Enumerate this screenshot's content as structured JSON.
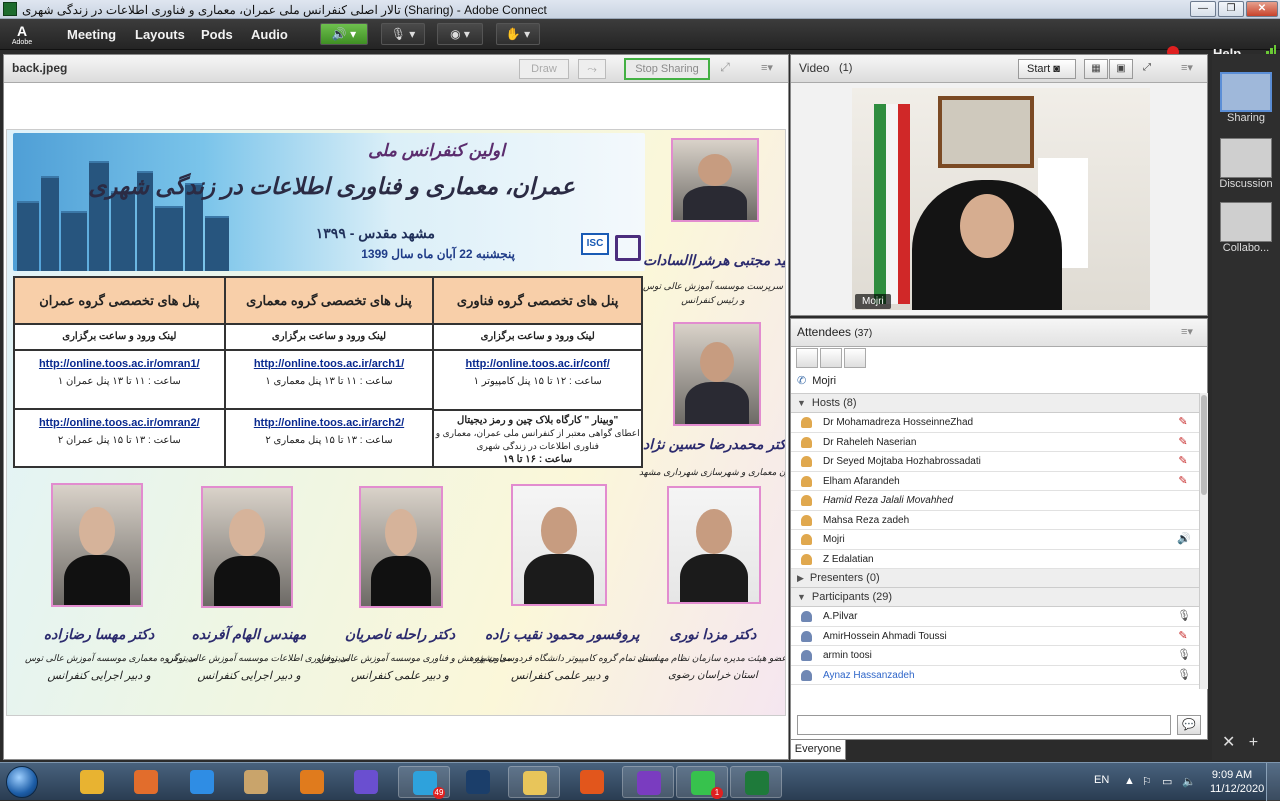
{
  "window": {
    "title": "تالار اصلی کنفرانس ملی عمران، معماری و فناوری اطلاعات در زندگی شهری (Sharing) - Adobe Connect",
    "min": "—",
    "max": "❐",
    "close": "✕"
  },
  "menubar": {
    "logo": "A",
    "logo_sub": "Adobe",
    "items": [
      "Meeting",
      "Layouts",
      "Pods",
      "Audio"
    ],
    "help": "Help"
  },
  "share_pod": {
    "title": "back.jpeg",
    "draw": "Draw",
    "stop_sharing": "Stop Sharing",
    "menu": "≡▾"
  },
  "slide": {
    "banner": {
      "conf": "اولین کنفرانس ملی",
      "title": "عمران، معماری و فناوری اطلاعات در زندگی شهری",
      "city": "۱۳۹۹ - مشهد مقدس",
      "date": "پنجشنبه 22 آبان ماه سال 1399",
      "isc": "ISC"
    },
    "panels": [
      {
        "heading": "پنل های تخصصی گروه عمران",
        "sub": "لینک ورود و ساعت برگزاری",
        "cells": [
          {
            "link": "http://online.toos.ac.ir/omran1/",
            "line1": "ساعت : ۱۱ تا ۱۳     پنل عمران ۱",
            "line2": ""
          },
          {
            "link": "http://online.toos.ac.ir/omran2/",
            "line1": "ساعت : ۱۳ تا ۱۵     پنل عمران ۲",
            "line2": ""
          }
        ]
      },
      {
        "heading": "پنل های تخصصی گروه معماری",
        "sub": "لینک ورود و ساعت برگزاری",
        "cells": [
          {
            "link": "http://online.toos.ac.ir/arch1/",
            "line1": "ساعت : ۱۱ تا ۱۳     پنل معماری ۱",
            "line2": ""
          },
          {
            "link": "http://online.toos.ac.ir/arch2/",
            "line1": "ساعت : ۱۳ تا ۱۵     پنل معماری ۲",
            "line2": ""
          }
        ]
      },
      {
        "heading": "پنل های تخصصی گروه فناوری اطلاعات",
        "sub": "لینک ورود و ساعت برگزاری",
        "cells": [
          {
            "link": "http://online.toos.ac.ir/conf/",
            "line1": "ساعت : ۱۲ تا ۱۵     پنل کامپیوتر ۱",
            "line2": ""
          },
          {
            "link": "وبینار \" کارگاه بلاک چین و رمز دیجیتال\"",
            "line1": "اعطای گواهی معتبر از کنفرانس ملی عمران، معماری و",
            "line2": "فناوری اطلاعات در زندگی شهری",
            "line3": "ساعت : ۱۶ تا ۱۹"
          }
        ]
      }
    ],
    "people_right": [
      {
        "name": "دکتر سید مجتبی هرشراالسادات",
        "role1": "سرپرست موسسه آموزش عالی توس",
        "role2": "و رئیس کنفرانس"
      },
      {
        "name": "دکتر محمدرضا حسین نژاد",
        "role1": "معاون معماری و شهرسازی شهرداری مشهد",
        "role2": ""
      }
    ],
    "people_bottom": [
      {
        "name": "دکتر مهسا رضازاده",
        "role1": "مدیر گروه معماری موسسه آموزش عالی توس",
        "role2": "و دبیر اجرایی کنفرانس"
      },
      {
        "name": "مهندس الهام آفرنده",
        "role1": "مدیر فناوری اطلاعات موسسه آموزش عالی توس",
        "role2": "و دبیر اجرایی کنفرانس"
      },
      {
        "name": "دکتر راحله ناصریان",
        "role1": "معاون پژوهش و فناوری موسسه آموزش عالی توس",
        "role2": "و دبیر علمی کنفرانس"
      },
      {
        "name": "پروفسور محمود نقیب زاده",
        "role1": "استاد تمام گروه کامپیوتر دانشگاه فردوسی مشهد",
        "role2": "و دبیر علمی کنفرانس"
      },
      {
        "name": "دکتر مزدا نوری",
        "role1": "عضو هیئت مدیره سازمان نظام مهندسی",
        "role2": "استان خراسان رضوی"
      }
    ]
  },
  "video_pod": {
    "title": "Video",
    "count": "(1)",
    "start": "Start",
    "menu": "≡▾",
    "speaker_name": "Mojri"
  },
  "attendees": {
    "title": "Attendees",
    "count": "(37)",
    "menu": "≡▾",
    "audio_speaker": "Mojri",
    "groups": [
      {
        "label": "Hosts (8)",
        "expanded": true,
        "members": [
          {
            "name": "Dr Mohamadreza HosseinneZhad",
            "icon": "mic-off-icon",
            "style": ""
          },
          {
            "name": "Dr Raheleh Naserian",
            "icon": "mic-off-icon",
            "style": ""
          },
          {
            "name": "Dr Seyed Mojtaba Hozhabrossadati",
            "icon": "mic-off-icon",
            "style": ""
          },
          {
            "name": "Elham Afarandeh",
            "icon": "mic-off-icon",
            "style": ""
          },
          {
            "name": "Hamid Reza Jalali Movahhed",
            "icon": "",
            "style": "italic"
          },
          {
            "name": "Mahsa Reza zadeh",
            "icon": "",
            "style": ""
          },
          {
            "name": "Mojri",
            "icon": "speaking-icon",
            "style": ""
          },
          {
            "name": "Z Edalatian",
            "icon": "",
            "style": ""
          }
        ]
      },
      {
        "label": "Presenters (0)",
        "expanded": false,
        "members": []
      },
      {
        "label": "Participants (29)",
        "expanded": true,
        "members": [
          {
            "name": "A.Pilvar",
            "icon": "mic-icon",
            "style": ""
          },
          {
            "name": "AmirHossein Ahmadi Toussi",
            "icon": "mic-off-icon",
            "style": ""
          },
          {
            "name": "armin toosi",
            "icon": "mic-icon",
            "style": ""
          },
          {
            "name": "Aynaz Hassanzadeh",
            "icon": "mic-icon",
            "style": "selected"
          }
        ]
      }
    ],
    "chat_tab": "Everyone"
  },
  "layouts": [
    {
      "label": "Sharing",
      "active": true
    },
    {
      "label": "Discussion",
      "active": false
    },
    {
      "label": "Collabo...",
      "active": false
    }
  ],
  "taskbar": {
    "lang": "EN",
    "time": "9:09 AM",
    "date": "11/12/2020",
    "apps": [
      {
        "name": "chrome-icon",
        "color": "#e8b331",
        "open": false
      },
      {
        "name": "media-player-icon",
        "color": "#e26d2c",
        "open": false
      },
      {
        "name": "internet-explorer-icon",
        "color": "#2f8de4",
        "open": false
      },
      {
        "name": "paint-icon",
        "color": "#c9a46b",
        "open": false
      },
      {
        "name": "eset-icon",
        "color": "#e07b1d",
        "open": false
      },
      {
        "name": "chat-app-icon",
        "color": "#6a4fd0",
        "open": false
      },
      {
        "name": "telegram-icon",
        "color": "#2ea2dc",
        "open": true,
        "badge": "49"
      },
      {
        "name": "photoshop-icon",
        "color": "#1b3e6a",
        "open": false
      },
      {
        "name": "file-explorer-icon",
        "color": "#e8c55a",
        "open": true
      },
      {
        "name": "firefox-icon",
        "color": "#e2561c",
        "open": false
      },
      {
        "name": "podcast-icon",
        "color": "#7a3cc0",
        "open": true
      },
      {
        "name": "whatsapp-icon",
        "color": "#37c24d",
        "open": true,
        "badge": "1"
      },
      {
        "name": "adobe-connect-icon",
        "color": "#1e7a3a",
        "open": true
      }
    ]
  }
}
